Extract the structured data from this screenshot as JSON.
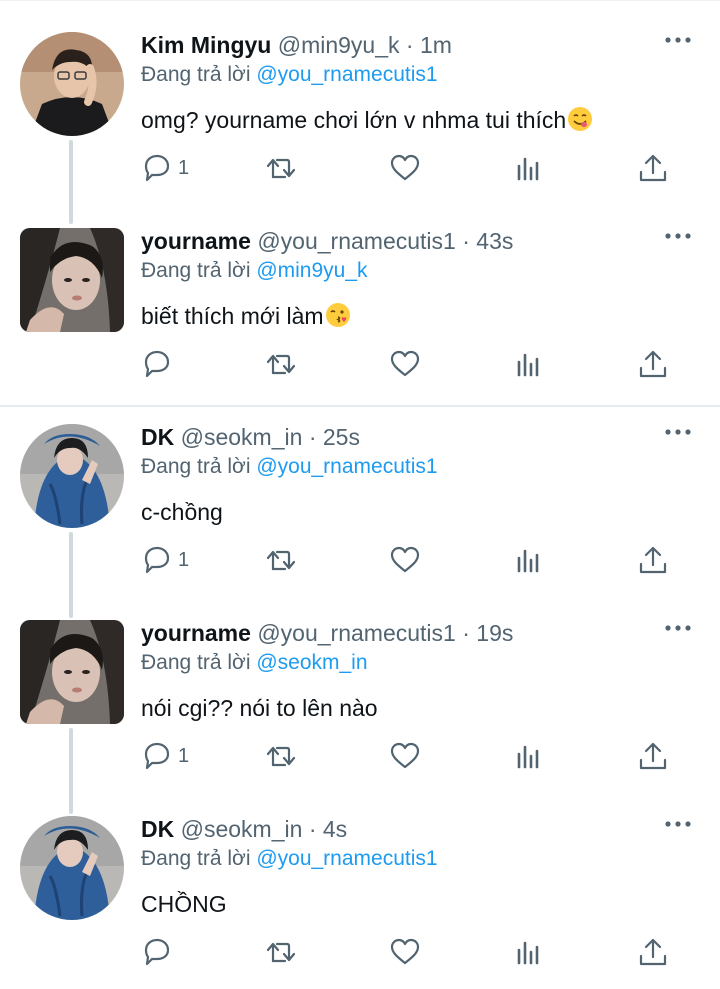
{
  "reply_prefix": "Đang trả lời",
  "colors": {
    "link": "#1d9bf0",
    "secondary": "#536471",
    "primary_text": "#0f1419",
    "thread_line": "#cfd9de"
  },
  "icons": {
    "reply": "comment-bubble-icon",
    "retweet": "retweet-icon",
    "like": "heart-icon",
    "views": "bar-chart-icon",
    "share": "share-upload-icon",
    "more": "more-dots-icon"
  },
  "tweets": [
    {
      "name": "Kim Mingyu",
      "handle": "@min9yu_k",
      "time": "1m",
      "replying_to": "@you_rnamecutis1",
      "text": "omg? yourname chơi lớn v nhma tui thích",
      "emoji": "savoring-food-emoji",
      "reply_count": "1"
    },
    {
      "name": "yourname",
      "handle": "@you_rnamecutis1",
      "time": "43s",
      "replying_to": "@min9yu_k",
      "text": "biết thích mới làm",
      "emoji": "kissing-face-emoji",
      "reply_count": ""
    },
    {
      "name": "DK",
      "handle": "@seokm_in",
      "time": "25s",
      "replying_to": "@you_rnamecutis1",
      "text": "c-chồng",
      "emoji": "",
      "reply_count": "1"
    },
    {
      "name": "yourname",
      "handle": "@you_rnamecutis1",
      "time": "19s",
      "replying_to": "@seokm_in",
      "text": "nói cgi?? nói to lên nào",
      "emoji": "",
      "reply_count": "1"
    },
    {
      "name": "DK",
      "handle": "@seokm_in",
      "time": "4s",
      "replying_to": "@you_rnamecutis1",
      "text": "CHỒNG",
      "emoji": "",
      "reply_count": ""
    }
  ]
}
